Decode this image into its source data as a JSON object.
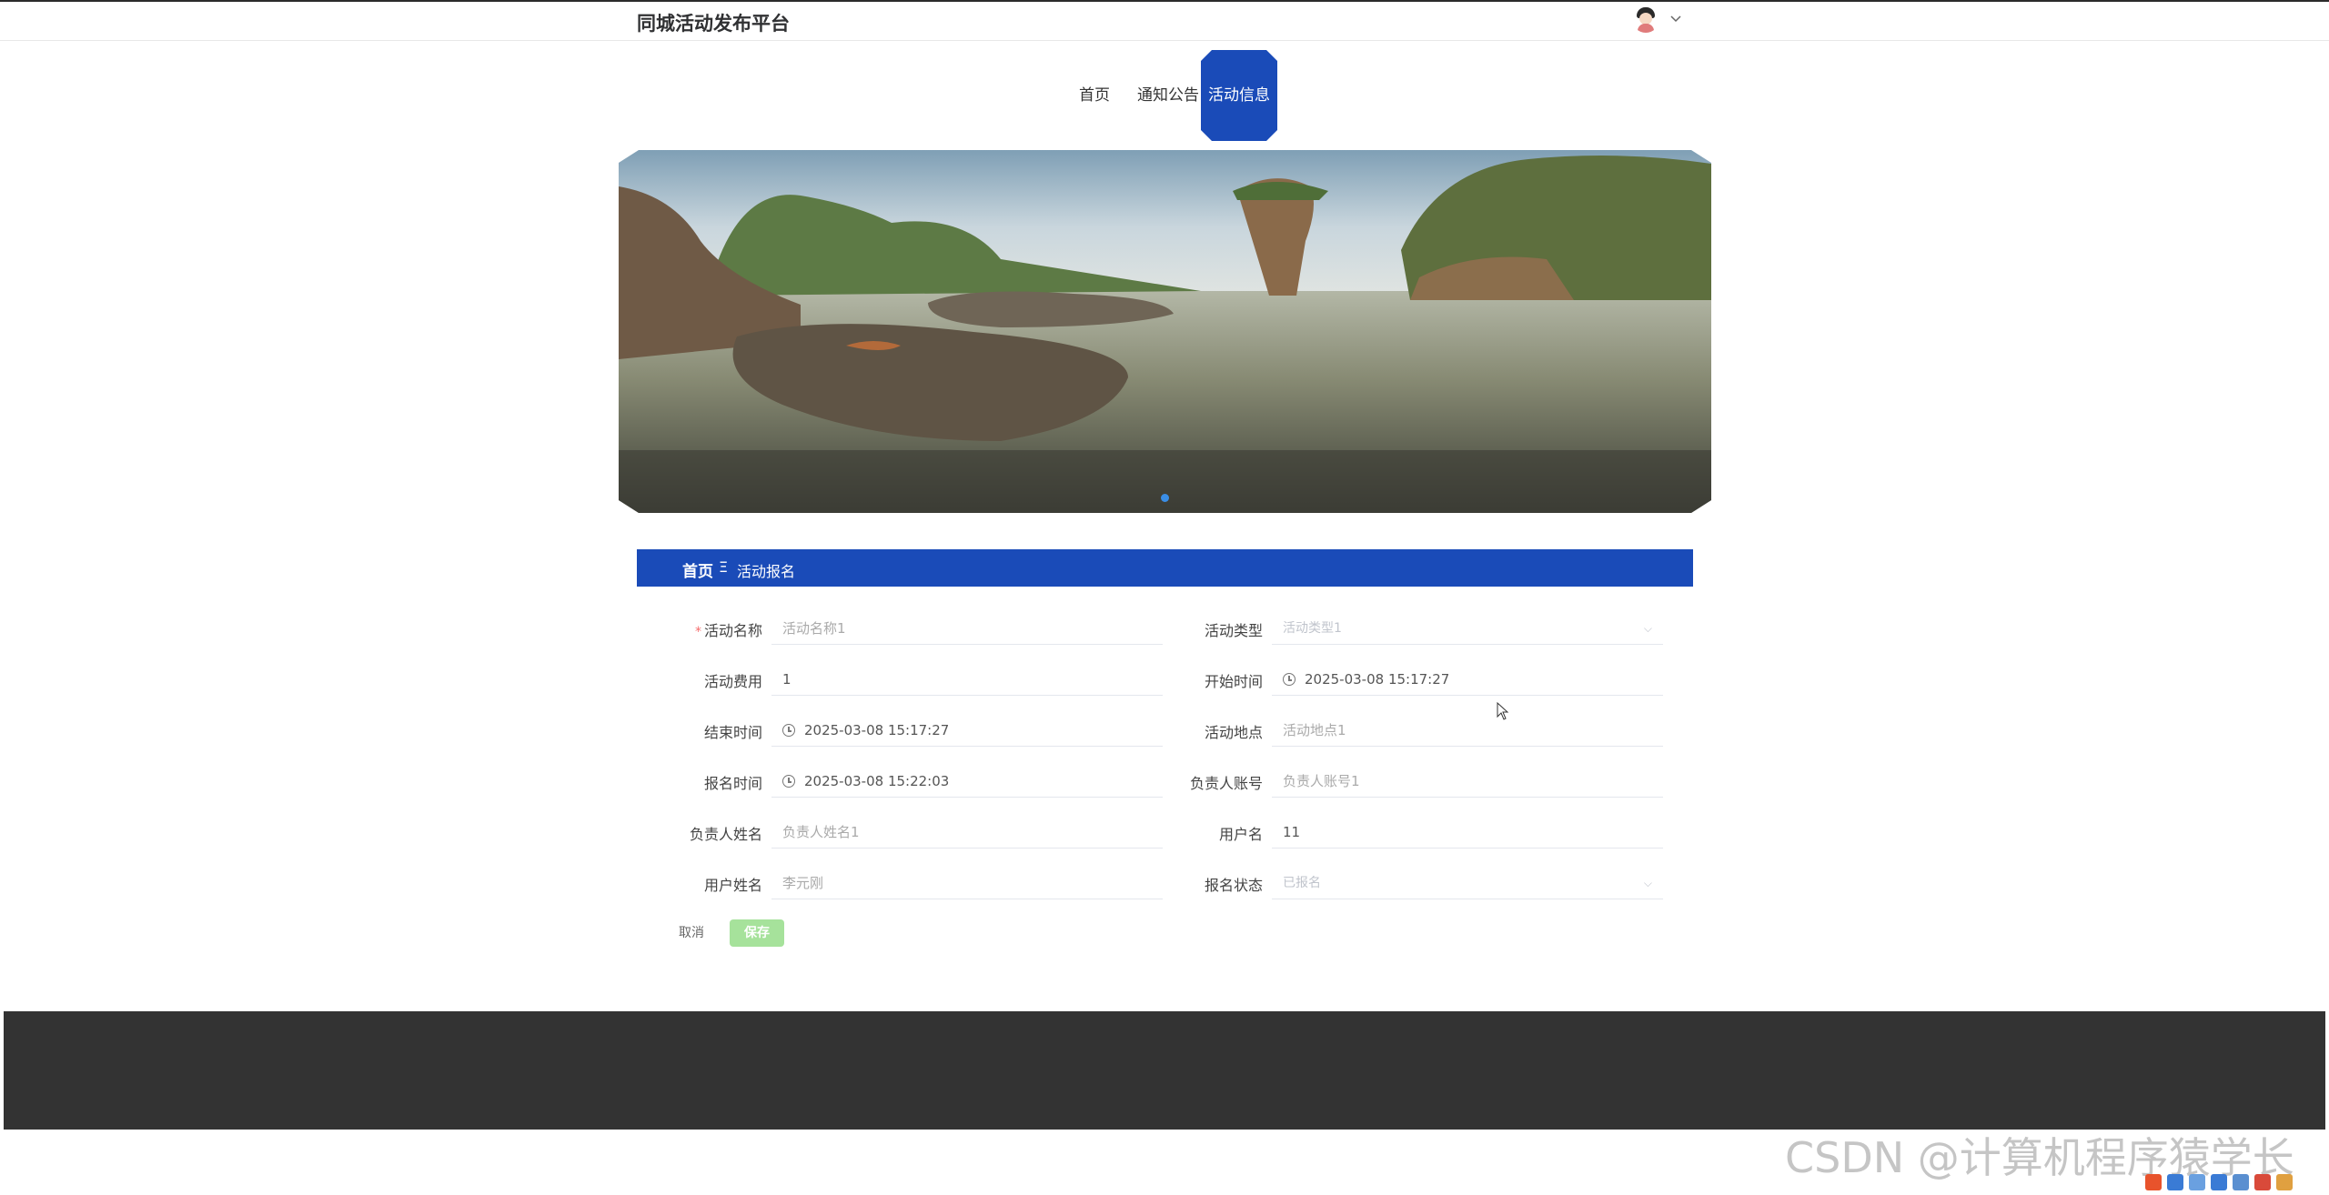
{
  "header": {
    "site_title": "同城活动发布平台",
    "avatar_icon": "user-avatar-icon",
    "caret_icon": "chevron-down-icon"
  },
  "nav": {
    "items": [
      {
        "label": "首页",
        "active": false
      },
      {
        "label": "通知公告",
        "active": false
      },
      {
        "label": "活动信息",
        "active": true
      }
    ],
    "active_color": "#1a4bb8"
  },
  "banner": {
    "slide_count": 1,
    "active_slide": 1
  },
  "breadcrumb": {
    "home": "首页",
    "separator": "Ξ",
    "current": "活动报名"
  },
  "form": {
    "activity_name": {
      "label": "活动名称",
      "required_mark": "*",
      "value": "活动名称1"
    },
    "activity_type": {
      "label": "活动类型",
      "value": "活动类型1"
    },
    "activity_fee": {
      "label": "活动费用",
      "value": "1"
    },
    "start_time": {
      "label": "开始时间",
      "value": "2025-03-08 15:17:27"
    },
    "end_time": {
      "label": "结束时间",
      "value": "2025-03-08 15:17:27"
    },
    "activity_location": {
      "label": "活动地点",
      "value": "活动地点1"
    },
    "signup_time": {
      "label": "报名时间",
      "value": "2025-03-08 15:22:03"
    },
    "manager_account": {
      "label": "负责人账号",
      "value": "负责人账号1"
    },
    "manager_name": {
      "label": "负责人姓名",
      "value": "负责人姓名1"
    },
    "username": {
      "label": "用户名",
      "value": "11"
    },
    "user_realname": {
      "label": "用户姓名",
      "value": "李元刚"
    },
    "signup_status": {
      "label": "报名状态",
      "value": "已报名"
    },
    "cancel_label": "取消",
    "save_label": "保存"
  },
  "watermark": "CSDN @计算机程序猿学长",
  "colors": {
    "primary": "#1a4bb8",
    "save_button": "#a6e29b",
    "footer": "#333333"
  }
}
